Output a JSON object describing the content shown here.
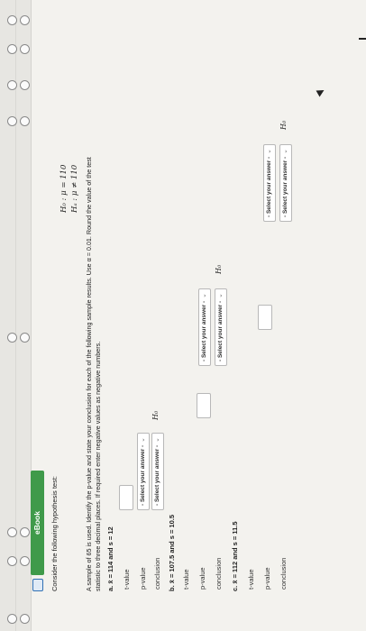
{
  "toolbar": {
    "ebook_label": "eBook",
    "book_icon": "book-icon"
  },
  "question": {
    "intro": "Consider the following hypothesis test:",
    "h0": "H₀ : μ = 110",
    "ha": "Hₐ : μ ≠ 110",
    "instructions_line1": "A sample of 65 is used. Identify the p-value and state your conclusion for each of the following sample results. Use α = 0.01. Round the value of the test",
    "instructions_line2": "statistic to three decimal places. If required enter negative values as negative numbers."
  },
  "parts": [
    {
      "heading": "a. x̄ = 114 and s = 12",
      "t_label": "t-value",
      "t_value": "",
      "p_label": "p-value",
      "p_select": "- Select your answer -",
      "conclusion_label": "conclusion",
      "conclusion_select": "- Select your answer -",
      "hypothesis": "H₀"
    },
    {
      "heading": "b. x̄ = 107.5 and s = 10.5",
      "t_label": "t-value",
      "t_value": "",
      "p_label": "p-value",
      "p_select": "- Select your answer -",
      "conclusion_label": "conclusion",
      "conclusion_select": "- Select your answer -",
      "hypothesis": "H₀"
    },
    {
      "heading": "c. x̄ = 112 and s = 11.5",
      "t_label": "t-value",
      "t_value": "",
      "p_label": "p-value",
      "p_select": "- Select your answer -",
      "conclusion_label": "conclusion",
      "conclusion_select": "- Select your answer -",
      "hypothesis": "H₀"
    }
  ],
  "nav": {
    "radio_count": 8
  }
}
